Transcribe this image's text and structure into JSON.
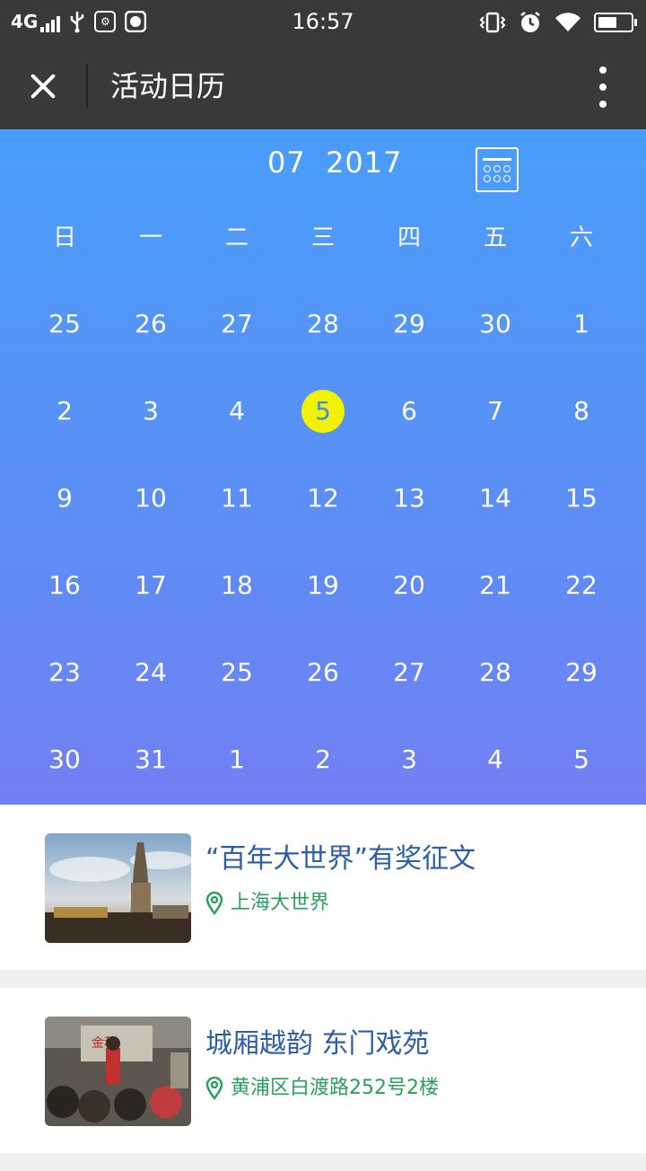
{
  "status_bar": {
    "network": "4G",
    "time": "16:57"
  },
  "title_bar": {
    "title": "活动日历",
    "close_icon": "close-icon",
    "more_icon": "more-vertical-icon"
  },
  "calendar": {
    "month_label": "07  2017",
    "weekdays": [
      "日",
      "一",
      "二",
      "三",
      "四",
      "五",
      "六"
    ],
    "days": [
      "25",
      "26",
      "27",
      "28",
      "29",
      "30",
      "1",
      "2",
      "3",
      "4",
      "5",
      "6",
      "7",
      "8",
      "9",
      "10",
      "11",
      "12",
      "13",
      "14",
      "15",
      "16",
      "17",
      "18",
      "19",
      "20",
      "21",
      "22",
      "23",
      "24",
      "25",
      "26",
      "27",
      "28",
      "29",
      "30",
      "31",
      "1",
      "2",
      "3",
      "4",
      "5"
    ],
    "selected_index": 10,
    "highlight_color": "#f2f200"
  },
  "events": [
    {
      "title": "“百年大世界”有奖征文",
      "location": "上海大世界"
    },
    {
      "title": "城厢越韵 东门戏苑",
      "location": "黄浦区白渡路252号2楼"
    }
  ],
  "colors": {
    "title_bar": "#38393b",
    "gradient_top": "#4a9dfa",
    "gradient_bottom": "#727ff3",
    "event_title": "#2c5ea6",
    "event_location": "#2aa05a"
  }
}
